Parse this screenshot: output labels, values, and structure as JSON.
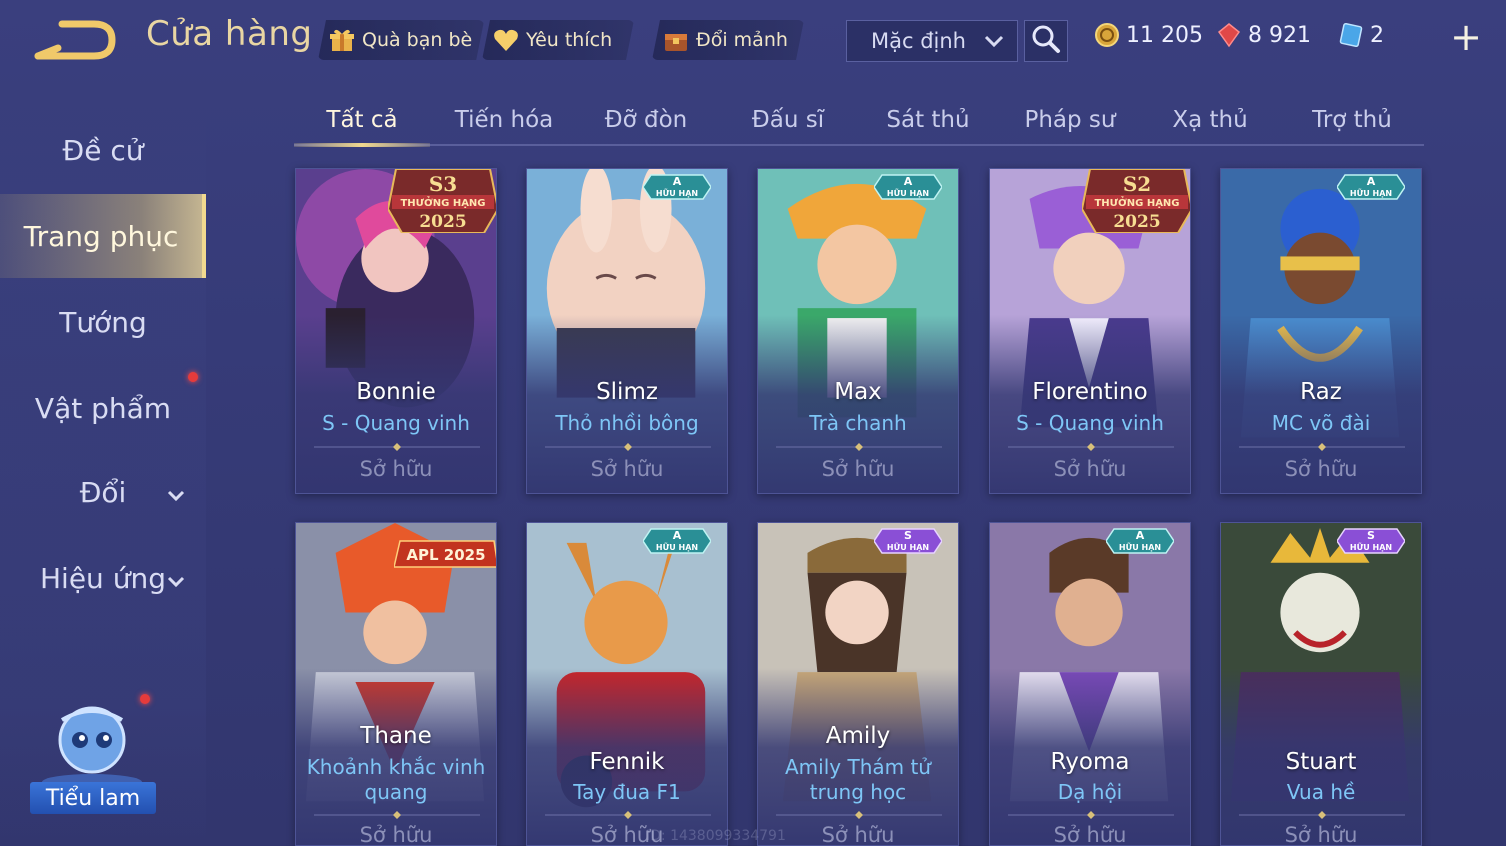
{
  "header": {
    "title": "Cửa hàng",
    "buttons": [
      {
        "label": "Quà bạn bè",
        "icon": "gift-icon"
      },
      {
        "label": "Yêu thích",
        "icon": "heart-icon"
      },
      {
        "label": "Đổi mảnh",
        "icon": "chest-icon"
      }
    ],
    "sort_select": {
      "value": "Mặc định"
    },
    "currencies": [
      {
        "icon": "gold-coin-icon",
        "value": "11 205"
      },
      {
        "icon": "red-gem-icon",
        "value": "8 921"
      },
      {
        "icon": "blue-ticket-icon",
        "value": "2"
      }
    ],
    "plus_label": "+"
  },
  "sidebar": {
    "items": [
      {
        "label": "Đề cử"
      },
      {
        "label": "Trang phục"
      },
      {
        "label": "Tướng"
      },
      {
        "label": "Vật phẩm"
      },
      {
        "label": "Đổi"
      },
      {
        "label": "Hiệu ứng"
      }
    ],
    "mascot_label": "Tiểu lam"
  },
  "tabs": [
    "Tất cả",
    "Tiến hóa",
    "Đỡ đòn",
    "Đấu sĩ",
    "Sát thủ",
    "Pháp sư",
    "Xạ thủ",
    "Trợ thủ"
  ],
  "active_tab": "Tất cả",
  "cards": [
    {
      "hero": "Bonnie",
      "skin": "S - Quang vinh",
      "status": "Sở hữu",
      "badge": {
        "type": "season",
        "top": "S3",
        "mid": "THƯỞNG HẠNG",
        "year": "2025"
      }
    },
    {
      "hero": "Slimz",
      "skin": "Thỏ nhồi bông",
      "status": "Sở hữu",
      "badge": {
        "type": "limited",
        "grade": "A",
        "text": "HỮU HẠN"
      }
    },
    {
      "hero": "Max",
      "skin": "Trà chanh",
      "status": "Sở hữu",
      "badge": {
        "type": "limited",
        "grade": "A",
        "text": "HỮU HẠN"
      }
    },
    {
      "hero": "Florentino",
      "skin": "S - Quang vinh",
      "status": "Sở hữu",
      "badge": {
        "type": "season",
        "top": "S2",
        "mid": "THƯỞNG HẠNG",
        "year": "2025"
      }
    },
    {
      "hero": "Raz",
      "skin": "MC võ đài",
      "status": "Sở hữu",
      "badge": {
        "type": "limited",
        "grade": "A",
        "text": "HỮU HẠN"
      }
    },
    {
      "hero": "Thane",
      "skin_lines": [
        "Khoảnh khắc vinh",
        "quang"
      ],
      "status": "Sở hữu",
      "badge": {
        "type": "apl",
        "text": "APL 2025"
      }
    },
    {
      "hero": "Fennik",
      "skin": "Tay đua F1",
      "status": "Sở hữu",
      "badge": {
        "type": "limited",
        "grade": "A",
        "text": "HỮU HẠN"
      }
    },
    {
      "hero": "Amily",
      "skin_lines": [
        "Amily Thám tử",
        "trung học"
      ],
      "status": "Sở hữu",
      "badge": {
        "type": "limited-s",
        "grade": "S",
        "text": "HỮU HẠN"
      }
    },
    {
      "hero": "Ryoma",
      "skin": "Dạ hội",
      "status": "Sở hữu",
      "badge": {
        "type": "limited",
        "grade": "A",
        "text": "HỮU HẠN"
      }
    },
    {
      "hero": "Stuart",
      "skin": "Vua hề",
      "status": "Sở hữu",
      "badge": {
        "type": "limited-s",
        "grade": "S",
        "text": "HỮU HẠN"
      }
    }
  ],
  "watermark": "ID: 1438099334791",
  "colors": {
    "background": "#363b78",
    "title_gold": "#e9d6a3",
    "skin_name_blue": "#7ec6f6",
    "owned_gray": "#8c90b8",
    "active_tab_underline": "#f1d98f",
    "limited_badge_teal": "#2aa6a6",
    "limited_badge_purple": "#8a4fd6"
  }
}
